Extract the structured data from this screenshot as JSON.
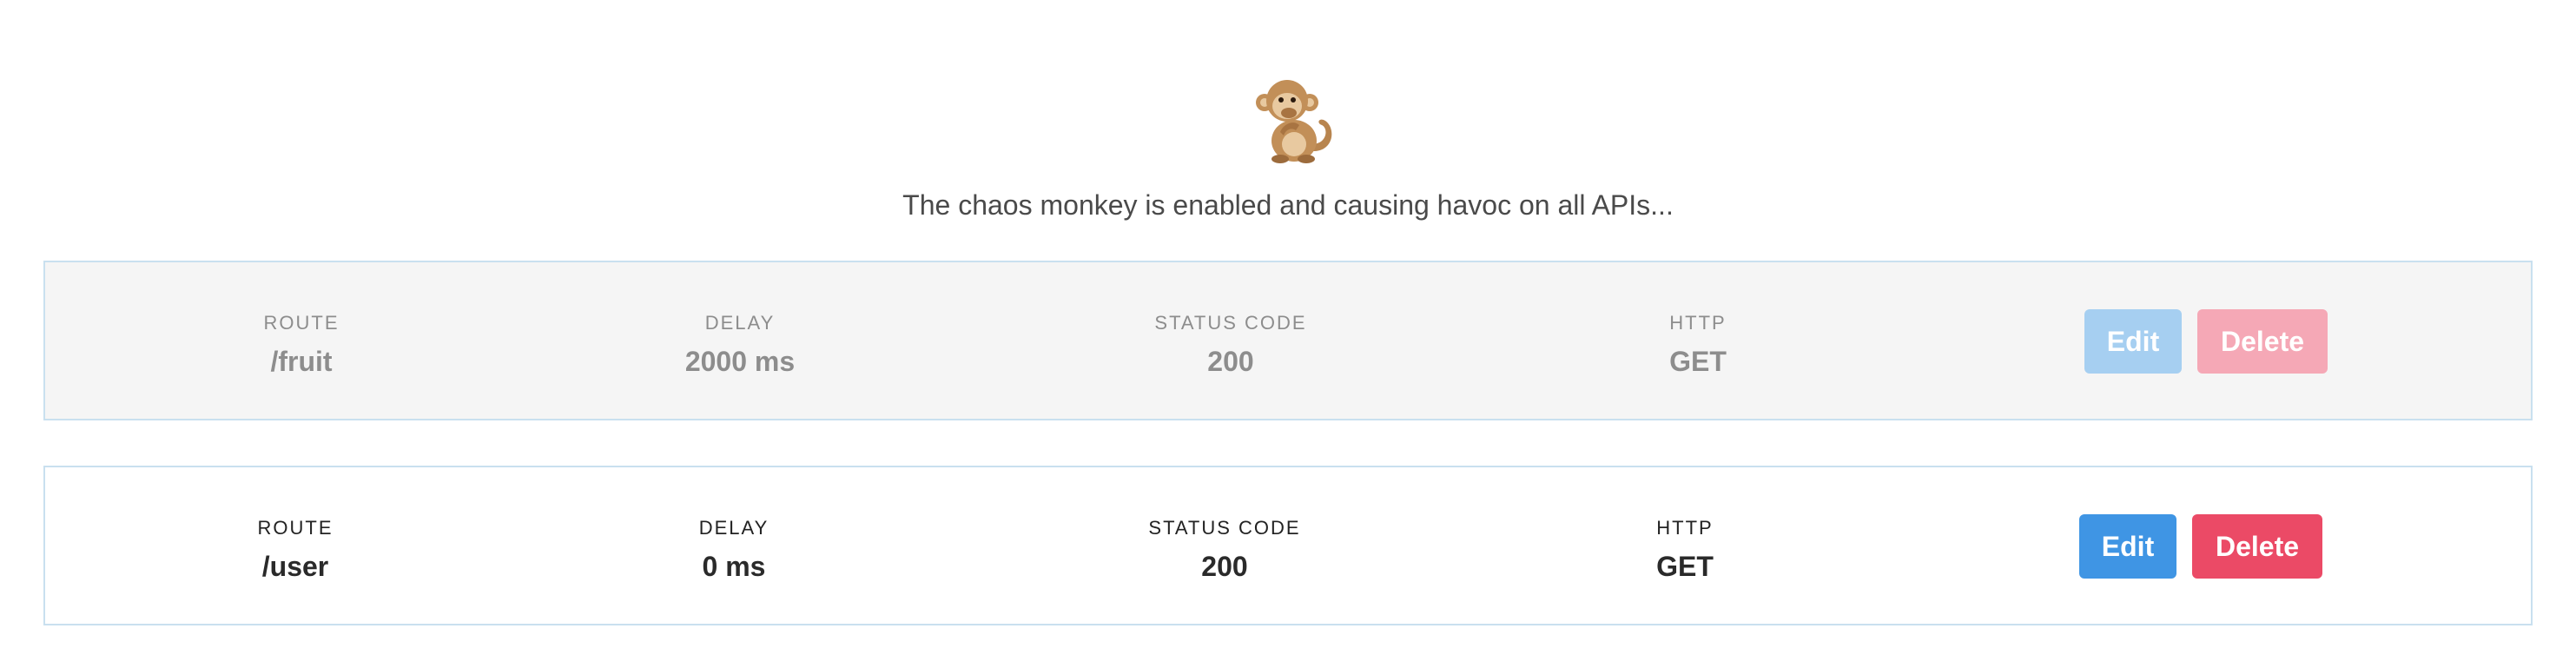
{
  "header": {
    "icon": "monkey-icon",
    "message": "The chaos monkey is enabled and causing havoc on all APIs..."
  },
  "labels": {
    "route": "ROUTE",
    "delay": "DELAY",
    "status_code": "STATUS CODE",
    "http": "HTTP"
  },
  "routes": [
    {
      "state": "disabled",
      "route": "/fruit",
      "delay": "2000 ms",
      "status_code": "200",
      "http": "GET",
      "edit_label": "Edit",
      "delete_label": "Delete"
    },
    {
      "state": "enabled",
      "route": "/user",
      "delay": "0 ms",
      "status_code": "200",
      "http": "GET",
      "edit_label": "Edit",
      "delete_label": "Delete"
    }
  ],
  "colors": {
    "edit": "#3f95e4",
    "delete": "#eb4a66",
    "edit_disabled": "#a6cff1",
    "delete_disabled": "#f5a8b6",
    "row_border": "#c9e0ef",
    "row_disabled_bg": "#f5f5f5"
  }
}
